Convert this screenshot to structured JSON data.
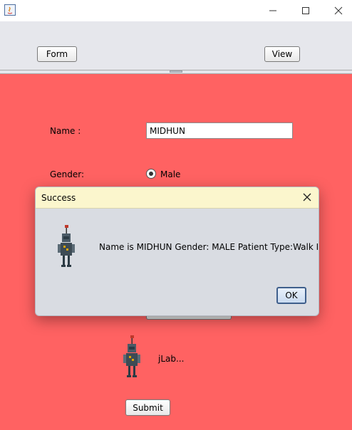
{
  "window": {
    "minimize_icon": "minimize-icon",
    "maximize_icon": "maximize-icon",
    "close_icon": "close-icon"
  },
  "toolbar": {
    "form_label": "Form",
    "view_label": "View"
  },
  "form": {
    "name_label": "Name :",
    "name_value": "MIDHUN",
    "gender_label": "Gender:",
    "gender_male_label": "Male",
    "robot_label": "jLab...",
    "submit_label": "Submit"
  },
  "dialog": {
    "title": "Success",
    "message": "Name is MIDHUN Gender: MALE Patient Type:Walk In",
    "ok_label": "OK"
  },
  "colors": {
    "form_background": "#ff6262",
    "dialog_title_background": "#fbf6cd",
    "dialog_background": "#d9dce2"
  }
}
